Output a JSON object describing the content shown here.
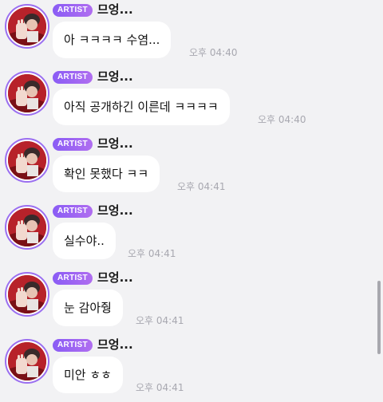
{
  "colors": {
    "background": "#f2f2f4",
    "bubble": "#ffffff",
    "badge_start": "#8a5cf5",
    "badge_end": "#b06ef0",
    "avatar_ring": "#9b6ff0",
    "timestamp": "#a8a8b0",
    "scrollbar": "#a8a8ae"
  },
  "messages": [
    {
      "badge": "ARTIST",
      "username": "므엉...",
      "text": "아 ㅋㅋㅋㅋ 수염...",
      "time": "오후 04:40"
    },
    {
      "badge": "ARTIST",
      "username": "므엉...",
      "text": "아직 공개하긴 이른데 ㅋㅋㅋㅋ",
      "time": "오후 04:40"
    },
    {
      "badge": "ARTIST",
      "username": "므엉...",
      "text": "확인 못했다 ㅋㅋ",
      "time": "오후 04:41"
    },
    {
      "badge": "ARTIST",
      "username": "므엉...",
      "text": "실수야..",
      "time": "오후 04:41"
    },
    {
      "badge": "ARTIST",
      "username": "므엉...",
      "text": "눈 감아줭",
      "time": "오후 04:41"
    },
    {
      "badge": "ARTIST",
      "username": "므엉...",
      "text": "미안 ㅎㅎ",
      "time": "오후 04:41"
    }
  ]
}
